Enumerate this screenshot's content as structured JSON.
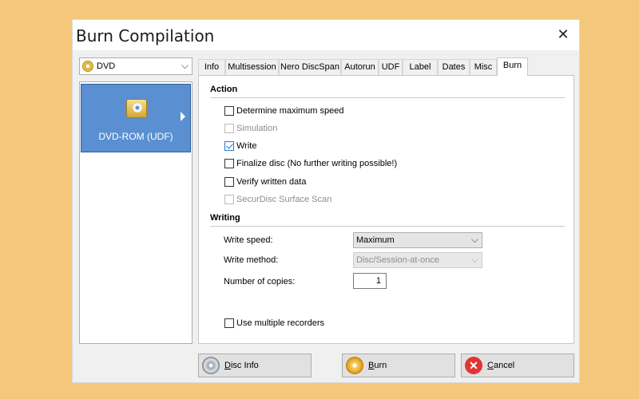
{
  "window": {
    "title": "Burn Compilation",
    "close_glyph": "✕"
  },
  "disc_type": {
    "selected": "DVD",
    "icon": "dvd-disc-icon"
  },
  "compilation_types": [
    {
      "label": "DVD-ROM (UDF)",
      "selected": true
    }
  ],
  "tabs": [
    {
      "label": "Info"
    },
    {
      "label": "Multisession"
    },
    {
      "label": "Nero DiscSpan"
    },
    {
      "label": "Autorun"
    },
    {
      "label": "UDF"
    },
    {
      "label": "Label"
    },
    {
      "label": "Dates"
    },
    {
      "label": "Misc"
    },
    {
      "label": "Burn",
      "active": true
    }
  ],
  "action": {
    "title": "Action",
    "options": [
      {
        "label": "Determine maximum speed",
        "checked": false,
        "enabled": true
      },
      {
        "label": "Simulation",
        "checked": false,
        "enabled": false
      },
      {
        "label": "Write",
        "checked": true,
        "enabled": true
      },
      {
        "label": "Finalize disc (No further writing possible!)",
        "checked": false,
        "enabled": true
      },
      {
        "label": "Verify written data",
        "checked": false,
        "enabled": true
      },
      {
        "label": "SecurDisc Surface Scan",
        "checked": false,
        "enabled": false
      }
    ]
  },
  "writing": {
    "title": "Writing",
    "write_speed_label": "Write speed:",
    "write_speed_value": "Maximum",
    "write_method_label": "Write method:",
    "write_method_value": "Disc/Session-at-once",
    "copies_label": "Number of copies:",
    "copies_value": "1",
    "multiple_recorders_label": "Use multiple recorders"
  },
  "buttons": {
    "disc_info": {
      "underline": "D",
      "rest": "isc Info"
    },
    "burn": {
      "underline": "B",
      "rest": "urn"
    },
    "cancel": {
      "underline": "C",
      "rest": "ancel"
    }
  },
  "colors": {
    "background": "#f4c77a",
    "selection": "#5a8fd2",
    "cancel_red": "#e13535"
  }
}
